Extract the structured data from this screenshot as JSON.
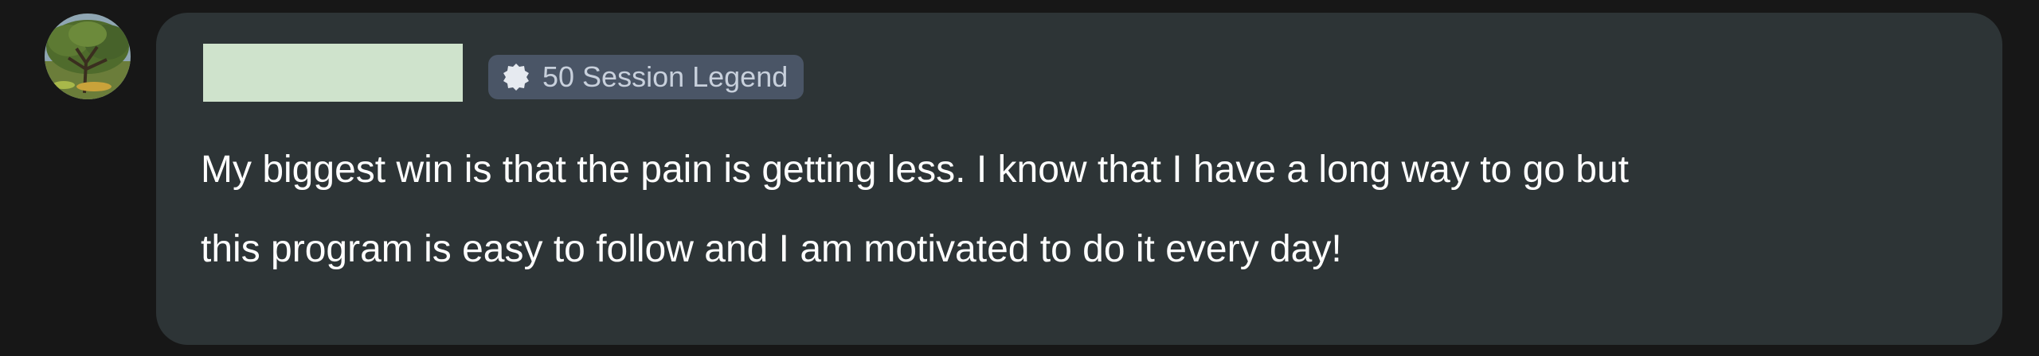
{
  "post": {
    "badge": {
      "icon": "badge-seal-icon",
      "label": "50 Session Legend"
    },
    "message_lines": [
      "My biggest win is that the pain is getting less. I know that I have a long way to go but",
      "this program is easy to follow and I am motivated to do it every day!"
    ]
  },
  "colors": {
    "page_background": "#171717",
    "card_background": "#2d3436",
    "badge_background": "#4a5566",
    "badge_text": "#c8d0dc",
    "redaction": "#cfe3cc",
    "message_text": "#ffffff"
  }
}
